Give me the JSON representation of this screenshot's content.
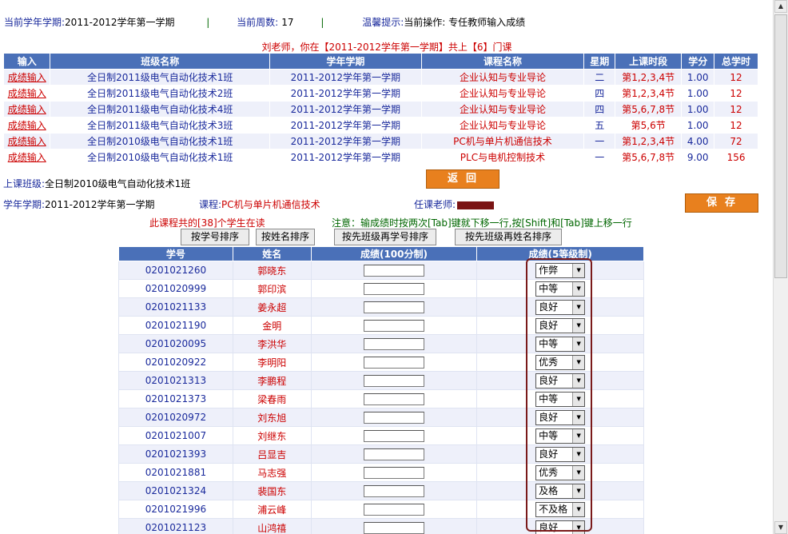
{
  "top": {
    "term_label": "当前学年学期:",
    "term_value": "2011-2012学年第一学期",
    "sep1": "|",
    "week_label": "当前周数:",
    "week_value": "17",
    "sep2": "|",
    "tip_label": "温馨提示:",
    "tip_value": "当前操作: 专任教师输入成绩"
  },
  "intro": "刘老师，你在【2011-2012学年第一学期】共上【6】门课",
  "courses": {
    "headers": [
      "输入",
      "班级名称",
      "学年学期",
      "课程名称",
      "星期",
      "上课时段",
      "学分",
      "总学时"
    ],
    "rows": [
      {
        "link": "成绩输入",
        "class": "全日制2011级电气自动化技术1班",
        "term": "2011-2012学年第一学期",
        "course": "企业认知与专业导论",
        "day": "二",
        "slot": "第1,2,3,4节",
        "credit": "1.00",
        "hours": "12"
      },
      {
        "link": "成绩输入",
        "class": "全日制2011级电气自动化技术2班",
        "term": "2011-2012学年第一学期",
        "course": "企业认知与专业导论",
        "day": "四",
        "slot": "第1,2,3,4节",
        "credit": "1.00",
        "hours": "12"
      },
      {
        "link": "成绩输入",
        "class": "全日制2011级电气自动化技术4班",
        "term": "2011-2012学年第一学期",
        "course": "企业认知与专业导论",
        "day": "四",
        "slot": "第5,6,7,8节",
        "credit": "1.00",
        "hours": "12"
      },
      {
        "link": "成绩输入",
        "class": "全日制2011级电气自动化技术3班",
        "term": "2011-2012学年第一学期",
        "course": "企业认知与专业导论",
        "day": "五",
        "slot": "第5,6节",
        "credit": "1.00",
        "hours": "12"
      },
      {
        "link": "成绩输入",
        "class": "全日制2010级电气自动化技术1班",
        "term": "2011-2012学年第一学期",
        "course": "PC机与单片机通信技术",
        "day": "一",
        "slot": "第1,2,3,4节",
        "credit": "4.00",
        "hours": "72"
      },
      {
        "link": "成绩输入",
        "class": "全日制2010级电气自动化技术1班",
        "term": "2011-2012学年第一学期",
        "course": "PLC与电机控制技术",
        "day": "一",
        "slot": "第5,6,7,8节",
        "credit": "9.00",
        "hours": "156"
      }
    ]
  },
  "back_label": "返回",
  "class_label": "上课班级:",
  "class_value": "全日制2010级电气自动化技术1班",
  "info": {
    "term_label": "学年学期:",
    "term_value": "2011-2012学年第一学期",
    "course_label": "课程:",
    "course_value": "PC机与单片机通信技术",
    "teacher_label": "任课老师:"
  },
  "save_label": "保存",
  "count_text": "此课程共的[38]个学生在读",
  "note_text": "注意：输成绩时按两次[Tab]键就下移一行,按[Shift]和[Tab]键上移一行",
  "sort_buttons": [
    "按学号排序",
    "按姓名排序",
    "按先班级再学号排序",
    "按先班级再姓名排序"
  ],
  "grades": {
    "headers": [
      "学号",
      "姓名",
      "成绩(100分制)",
      "成绩(5等级制)"
    ],
    "rows": [
      {
        "id": "0201021260",
        "name": "郭晓东",
        "score": "",
        "grade": "作弊"
      },
      {
        "id": "0201020999",
        "name": "郭印滨",
        "score": "",
        "grade": "中等"
      },
      {
        "id": "0201021133",
        "name": "姜永超",
        "score": "",
        "grade": "良好"
      },
      {
        "id": "0201021190",
        "name": "金明",
        "score": "",
        "grade": "良好"
      },
      {
        "id": "0201020095",
        "name": "李洪华",
        "score": "",
        "grade": "中等"
      },
      {
        "id": "0201020922",
        "name": "李明阳",
        "score": "",
        "grade": "优秀"
      },
      {
        "id": "0201021313",
        "name": "李鹏程",
        "score": "",
        "grade": "良好"
      },
      {
        "id": "0201021373",
        "name": "梁春雨",
        "score": "",
        "grade": "中等"
      },
      {
        "id": "0201020972",
        "name": "刘东旭",
        "score": "",
        "grade": "良好"
      },
      {
        "id": "0201021007",
        "name": "刘继东",
        "score": "",
        "grade": "中等"
      },
      {
        "id": "0201021393",
        "name": "吕显吉",
        "score": "",
        "grade": "良好"
      },
      {
        "id": "0201021881",
        "name": "马志强",
        "score": "",
        "grade": "优秀"
      },
      {
        "id": "0201021324",
        "name": "裴国东",
        "score": "",
        "grade": "及格"
      },
      {
        "id": "0201021996",
        "name": "浦云峰",
        "score": "",
        "grade": "不及格"
      },
      {
        "id": "0201021123",
        "name": "山鸿禧",
        "score": "",
        "grade": "良好"
      }
    ]
  },
  "colors": {
    "header_bg": "#4a70b8",
    "button_orange": "#e8801e",
    "link_red": "#cc0000",
    "text_blue": "#1a2a9c",
    "note_green": "#006600"
  }
}
